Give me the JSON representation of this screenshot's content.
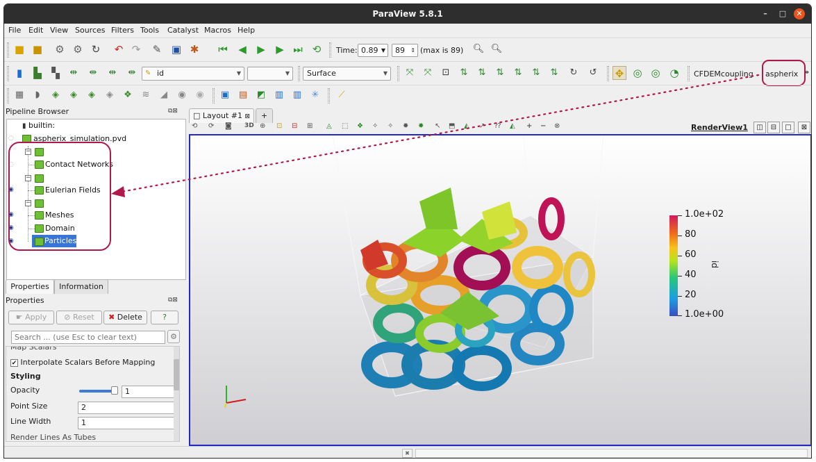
{
  "window": {
    "title": "ParaView 5.8.1",
    "minimize_glyph": "–",
    "maximize_glyph": "□",
    "close_glyph": "✕"
  },
  "menu": [
    "File",
    "Edit",
    "View",
    "Sources",
    "Filters",
    "Tools",
    "Catalyst",
    "Macros",
    "Help"
  ],
  "toolbar_time": {
    "time_label": "Time:",
    "time_value": "0.89",
    "step_value": "89",
    "max_label": "(max is 89)"
  },
  "toolbar_display": {
    "color_by_value": "id",
    "component_value": "",
    "representation_value": "Surface",
    "custom_label_1": "CFDEMcoupling",
    "custom_label_2": "aspherix",
    "overflow_glyph": "»"
  },
  "pipeline": {
    "title": "Pipeline Browser",
    "root": "builtin:",
    "file": "aspherix_simulation.pvd",
    "groups": [
      {
        "label": "Contact Networks"
      },
      {
        "label": "Eulerian Fields"
      },
      {
        "label": "Meshes"
      },
      {
        "label": "Domain"
      },
      {
        "label": "Particles",
        "selected": true
      }
    ]
  },
  "properties": {
    "tabs": [
      "Properties",
      "Information"
    ],
    "section_title": "Properties",
    "apply_label": "Apply",
    "reset_label": "Reset",
    "delete_label": "Delete",
    "help_label": "?",
    "search_placeholder": "Search ... (use Esc to clear text)",
    "cut_top_row": "Map Scalars",
    "interpolate_label": "Interpolate Scalars Before Mapping",
    "styling_title": "Styling",
    "opacity_label": "Opacity",
    "opacity_value": "1",
    "point_size_label": "Point Size",
    "point_size_value": "2",
    "line_width_label": "Line Width",
    "line_width_value": "1",
    "cut_bottom_row": "Render Lines As Tubes"
  },
  "layout": {
    "tab_label": "Layout #1",
    "add_tab": "+",
    "view_label": "RenderView1"
  },
  "colorbar": {
    "title": "id",
    "labels": [
      "1.0e+02",
      "80",
      "60",
      "40",
      "20",
      "1.0e+00"
    ],
    "colors": {
      "low": "#3b4cc0",
      "mid": "#b8e31a",
      "high": "#d11a5c"
    }
  },
  "accent_colors": {
    "highlight": "#b0174a",
    "selection": "#3875d7",
    "view_border": "#2028c8"
  }
}
